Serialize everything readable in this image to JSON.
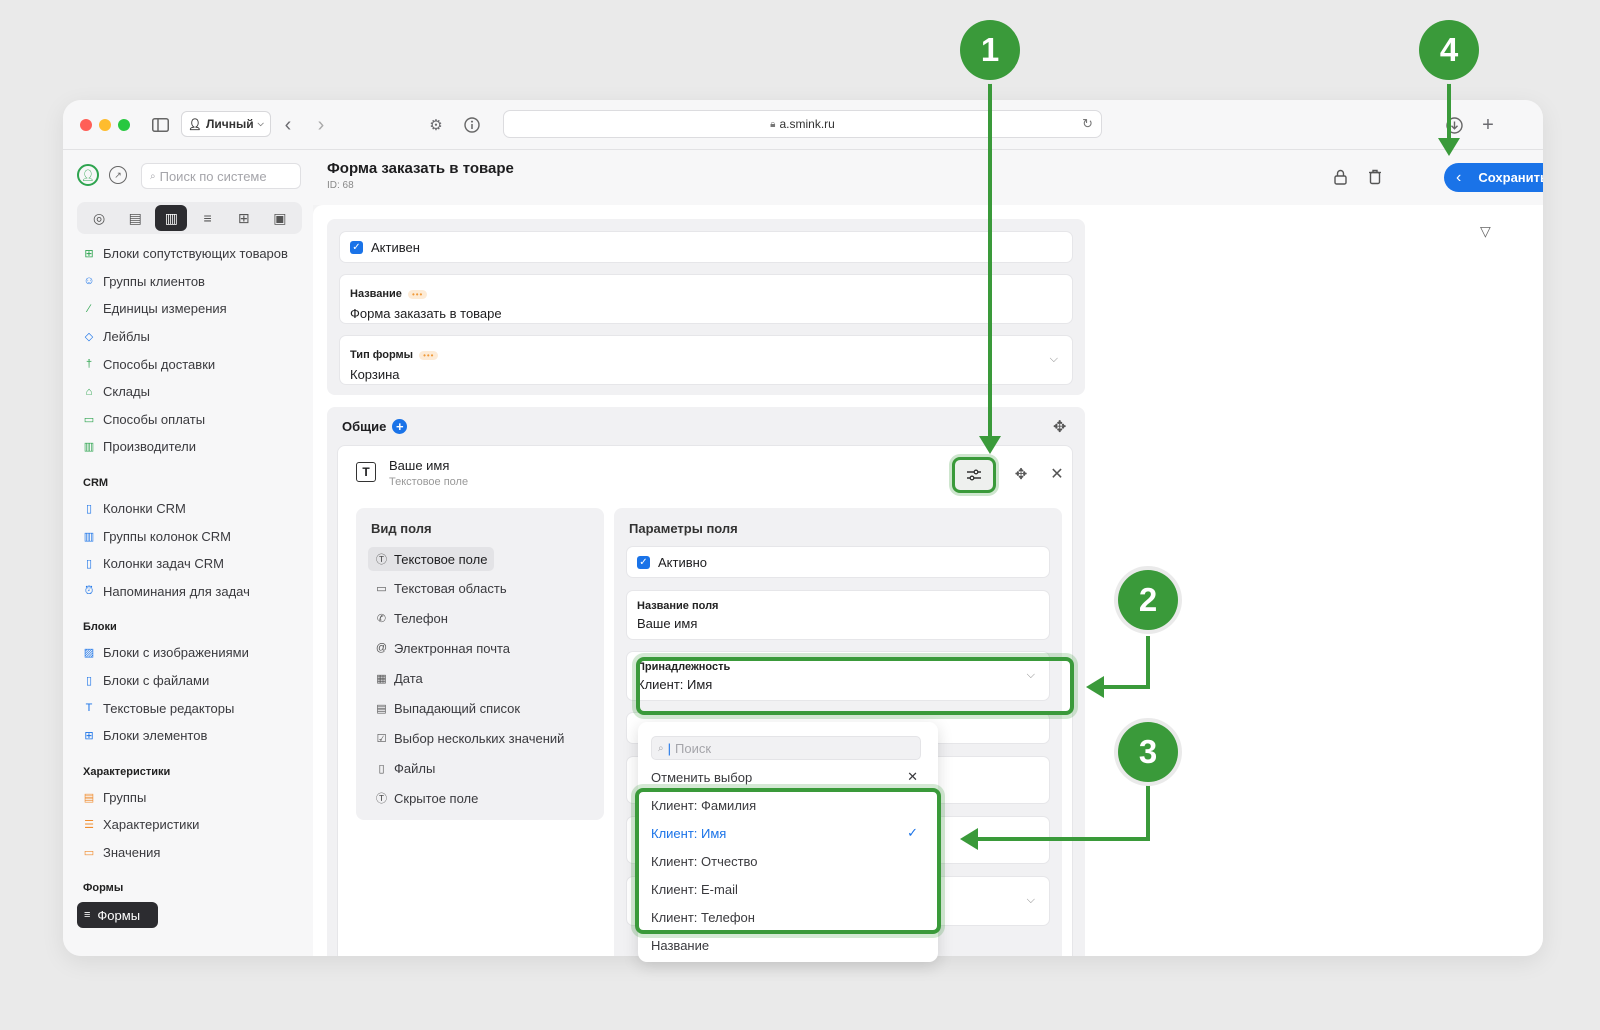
{
  "browser": {
    "profile": "Личный",
    "url": "a.smink.ru"
  },
  "sidebar": {
    "search_placeholder": "Поиск по системе",
    "tab_icons": [
      "dashboard-icon",
      "catalog-icon",
      "book-icon",
      "sliders-icon",
      "plus-square-icon",
      "paint-roller-icon"
    ],
    "items_top": [
      {
        "label": "Блоки сопутствующих товаров",
        "icon": "grid-icon"
      },
      {
        "label": "Группы клиентов",
        "icon": "users-icon"
      },
      {
        "label": "Единицы измерения",
        "icon": "ruler-icon"
      },
      {
        "label": "Лейблы",
        "icon": "tag-icon"
      },
      {
        "label": "Способы доставки",
        "icon": "walk-icon"
      },
      {
        "label": "Склады",
        "icon": "warehouse-icon"
      },
      {
        "label": "Способы оплаты",
        "icon": "card-icon"
      },
      {
        "label": "Производители",
        "icon": "factory-icon"
      }
    ],
    "section_crm": "CRM",
    "items_crm": [
      {
        "label": "Колонки CRM",
        "icon": "column-icon"
      },
      {
        "label": "Группы колонок CRM",
        "icon": "columns-icon"
      },
      {
        "label": "Колонки задач CRM",
        "icon": "column-icon"
      },
      {
        "label": "Напоминания для задач",
        "icon": "alarm-icon"
      }
    ],
    "section_blocks": "Блоки",
    "items_blocks": [
      {
        "label": "Блоки с изображениями",
        "icon": "image-icon"
      },
      {
        "label": "Блоки с файлами",
        "icon": "file-icon"
      },
      {
        "label": "Текстовые редакторы",
        "icon": "text-icon"
      },
      {
        "label": "Блоки элементов",
        "icon": "grid-icon"
      }
    ],
    "section_chars": "Характеристики",
    "items_chars": [
      {
        "label": "Группы",
        "icon": "doc-icon"
      },
      {
        "label": "Характеристики",
        "icon": "list-icon"
      },
      {
        "label": "Значения",
        "icon": "value-icon"
      }
    ],
    "section_forms": "Формы",
    "active_item": "Формы"
  },
  "header": {
    "title": "Форма заказать в товаре",
    "id": "ID: 68",
    "save_label": "Сохранить"
  },
  "form": {
    "active_label": "Активен",
    "name_label": "Название",
    "name_value": "Форма заказать в товаре",
    "type_label": "Тип формы",
    "type_value": "Корзина"
  },
  "section": {
    "title": "Общие",
    "field_title": "Ваше имя",
    "field_subtitle": "Текстовое поле"
  },
  "field_types": {
    "title": "Вид поля",
    "items": [
      {
        "label": "Текстовое поле",
        "icon": "text-field-icon",
        "selected": true
      },
      {
        "label": "Текстовая область",
        "icon": "textarea-icon"
      },
      {
        "label": "Телефон",
        "icon": "phone-icon"
      },
      {
        "label": "Электронная почта",
        "icon": "at-icon"
      },
      {
        "label": "Дата",
        "icon": "calendar-icon"
      },
      {
        "label": "Выпадающий список",
        "icon": "dropdown-list-icon"
      },
      {
        "label": "Выбор нескольких значений",
        "icon": "checkbox-icon"
      },
      {
        "label": "Файлы",
        "icon": "file-icon"
      },
      {
        "label": "Скрытое поле",
        "icon": "hidden-field-icon"
      }
    ]
  },
  "field_params": {
    "title": "Параметры поля",
    "active_label": "Активно",
    "name_label": "Название поля",
    "name_value": "Ваше имя",
    "belong_label": "Принадлежность",
    "belong_value": "Клиент: Имя"
  },
  "dropdown": {
    "search_placeholder": "Поиск",
    "clear_label": "Отменить выбор",
    "options": [
      {
        "label": "Клиент: Фамилия",
        "selected": false
      },
      {
        "label": "Клиент: Имя",
        "selected": true
      },
      {
        "label": "Клиент: Отчество",
        "selected": false
      },
      {
        "label": "Клиент: E-mail",
        "selected": false
      },
      {
        "label": "Клиент: Телефон",
        "selected": false
      },
      {
        "label": "Название",
        "selected": false
      }
    ]
  },
  "annotations": {
    "badges": [
      "1",
      "2",
      "3",
      "4"
    ],
    "color": "#3a9a3a"
  },
  "colors": {
    "accent": "#1a73e8",
    "annotation": "#3a9a3a"
  }
}
